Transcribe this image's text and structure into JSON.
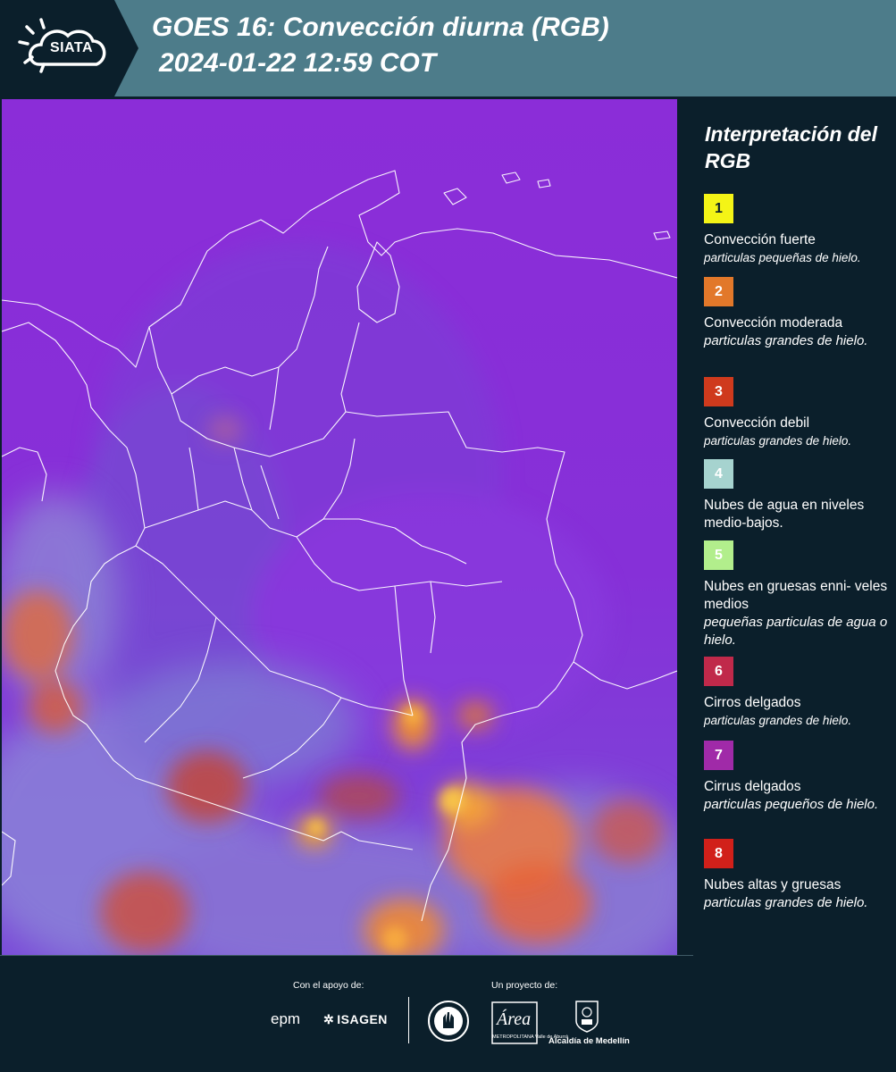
{
  "header": {
    "logo_text": "SIATA",
    "title": "GOES 16: Convección diurna (RGB)",
    "datetime": "2024-01-22 12:59 COT"
  },
  "legend": {
    "title": "Interpretación del RGB",
    "items": [
      {
        "number": "1",
        "color": "#f4f416",
        "name": "Convección fuerte",
        "desc": "particulas pequeñas de hielo."
      },
      {
        "number": "2",
        "color": "#e2782a",
        "name": "Convección moderada",
        "desc": "particulas grandes de hielo."
      },
      {
        "number": "3",
        "color": "#cf3a1d",
        "name": "Convección debil",
        "desc": "particulas grandes de hielo."
      },
      {
        "number": "4",
        "color": "#a6d3cf",
        "name": "Nubes de agua en niveles medio-bajos.",
        "desc": ""
      },
      {
        "number": "5",
        "color": "#b2ee8c",
        "name": "Nubes en gruesas enni- veles medios",
        "desc": "pequeñas particulas de agua o hielo."
      },
      {
        "number": "6",
        "color": "#c0294a",
        "name": "Cirros delgados",
        "desc": "particulas grandes de hielo."
      },
      {
        "number": "7",
        "color": "#a02aa8",
        "name": "Cirrus delgados",
        "desc": "particulas pequeños de hielo."
      },
      {
        "number": "8",
        "color": "#d1201a",
        "name": "Nubes altas y gruesas",
        "desc": "particulas grandes de hielo."
      }
    ]
  },
  "footer": {
    "support_label": "Con el apoyo de:",
    "project_label": "Un proyecto de:",
    "epm": "epm",
    "isagen": "ISAGEN",
    "area_metropolitana": "METROPOLITANA Valle de Aburrá",
    "area_script": "Área",
    "alcaldia": "Alcaldía de Medellín"
  },
  "colors": {
    "header_bg": "#4d7c8a",
    "page_bg": "#0b1f2b",
    "map_base": "#8c2fd9"
  }
}
